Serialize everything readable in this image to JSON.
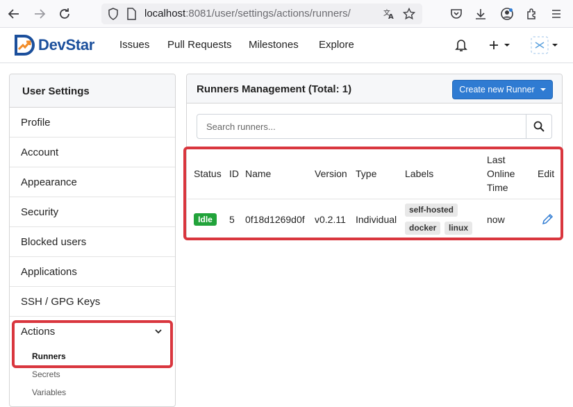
{
  "browser": {
    "url_host": "localhost",
    "url_rest": ":8081/user/settings/actions/runners/"
  },
  "header": {
    "logo_text": "DevStar",
    "nav": [
      "Issues",
      "Pull Requests",
      "Milestones",
      "Explore"
    ]
  },
  "sidebar": {
    "title": "User Settings",
    "items": [
      "Profile",
      "Account",
      "Appearance",
      "Security",
      "Blocked users",
      "Applications",
      "SSH / GPG Keys"
    ],
    "actions_label": "Actions",
    "sub_items": [
      "Runners",
      "Secrets",
      "Variables"
    ]
  },
  "panel": {
    "title": "Runners Management (Total: 1)",
    "create_button": "Create new Runner",
    "search_placeholder": "Search runners..."
  },
  "table": {
    "headers": {
      "status": "Status",
      "id": "ID",
      "name": "Name",
      "version": "Version",
      "type": "Type",
      "labels": "Labels",
      "last_online_1": "Last",
      "last_online_2": "Online",
      "last_online_3": "Time",
      "edit": "Edit"
    },
    "rows": [
      {
        "status": "Idle",
        "id": "5",
        "name": "0f18d1269d0f",
        "version": "v0.2.11",
        "type": "Individual",
        "labels": [
          "self-hosted",
          "docker",
          "linux"
        ],
        "last_online": "now"
      }
    ]
  },
  "colors": {
    "accent": "#2f7bd2",
    "idle": "#21a33a",
    "highlight": "#d9363e",
    "logo": "#1b4f9c"
  }
}
